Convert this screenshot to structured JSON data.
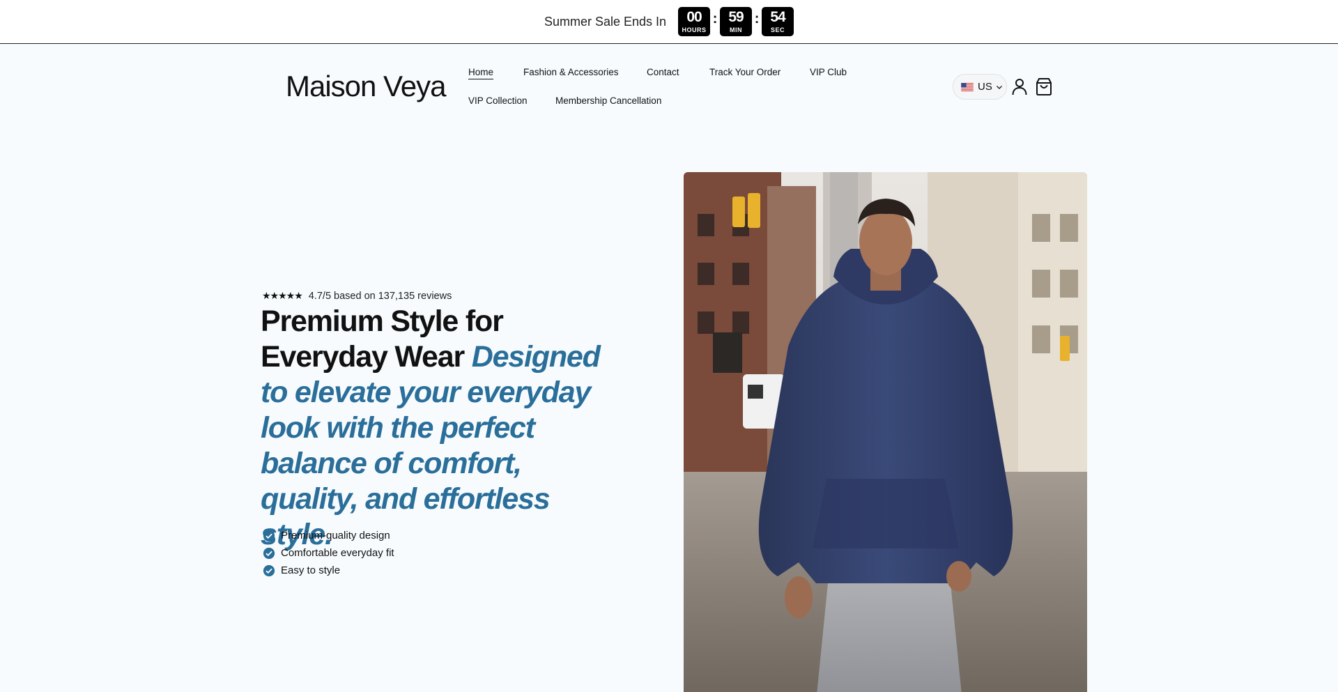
{
  "announcement": {
    "text": "Summer Sale Ends In",
    "countdown": [
      {
        "value": "00",
        "label": "HOURS"
      },
      {
        "value": "59",
        "label": "MIN"
      },
      {
        "value": "54",
        "label": "SEC"
      }
    ],
    "separator": ":"
  },
  "header": {
    "logo": "Maison Veya",
    "nav": [
      {
        "label": "Home",
        "active": true
      },
      {
        "label": "Fashion & Accessories"
      },
      {
        "label": "Contact"
      },
      {
        "label": "Track Your Order"
      },
      {
        "label": "VIP Club"
      },
      {
        "label": "VIP Collection"
      },
      {
        "label": "Membership Cancellation"
      }
    ],
    "country": {
      "code": "US",
      "flag_icon": "us-flag-icon"
    },
    "icons": [
      "account-icon",
      "cart-icon"
    ]
  },
  "hero": {
    "stars": "★★★★★",
    "rating_text": "4.7/5 based on 137,135 reviews",
    "headline_plain": "Premium Style for Everyday Wear",
    "headline_accent": "Designed to elevate your everyday look with the perfect balance of comfort, quality, and effortless style.",
    "features": [
      "Premium-quality design",
      "Comfortable everyday fit",
      "Easy to style"
    ],
    "accent_color": "#2a6e9a"
  }
}
